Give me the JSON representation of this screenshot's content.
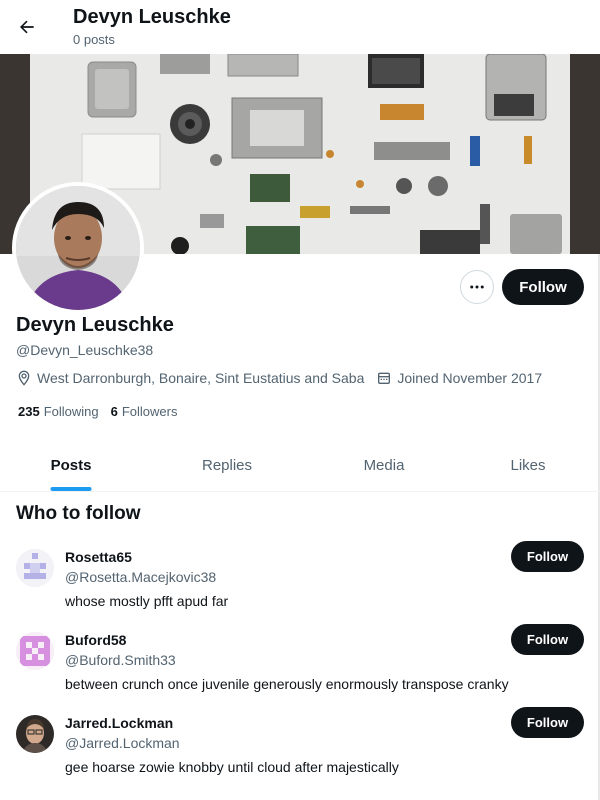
{
  "header": {
    "back_icon": "arrow-left-icon",
    "name": "Devyn Leuschke",
    "posts": "0 posts"
  },
  "profile": {
    "name": "Devyn Leuschke",
    "handle": "@Devyn_Leuschke38",
    "location": "West Darronburgh, Bonaire, Sint Eustatius and Saba",
    "joined": "Joined November 2017",
    "following_count": "235",
    "following_label": "Following",
    "followers_count": "6",
    "followers_label": "Followers",
    "follow_label": "Follow",
    "more_icon": "more-horizontal-icon"
  },
  "tabs": [
    {
      "label": "Posts",
      "active": true
    },
    {
      "label": "Replies",
      "active": false
    },
    {
      "label": "Media",
      "active": false
    },
    {
      "label": "Likes",
      "active": false
    }
  ],
  "who_to_follow": {
    "title": "Who to follow",
    "items": [
      {
        "name": "Rosetta65",
        "handle": "@Rosetta.Macejkovic38",
        "bio": "whose mostly pfft apud far",
        "button": "Follow"
      },
      {
        "name": "Buford58",
        "handle": "@Buford.Smith33",
        "bio": "between crunch once juvenile generously enormously transpose cranky",
        "button": "Follow"
      },
      {
        "name": "Jarred.Lockman",
        "handle": "@Jarred.Lockman",
        "bio": "gee hoarse zowie knobby until cloud after majestically",
        "button": "Follow"
      }
    ]
  },
  "colors": {
    "accent": "#1d9bf0",
    "button_bg": "#0f1419",
    "secondary_text": "#536471"
  }
}
